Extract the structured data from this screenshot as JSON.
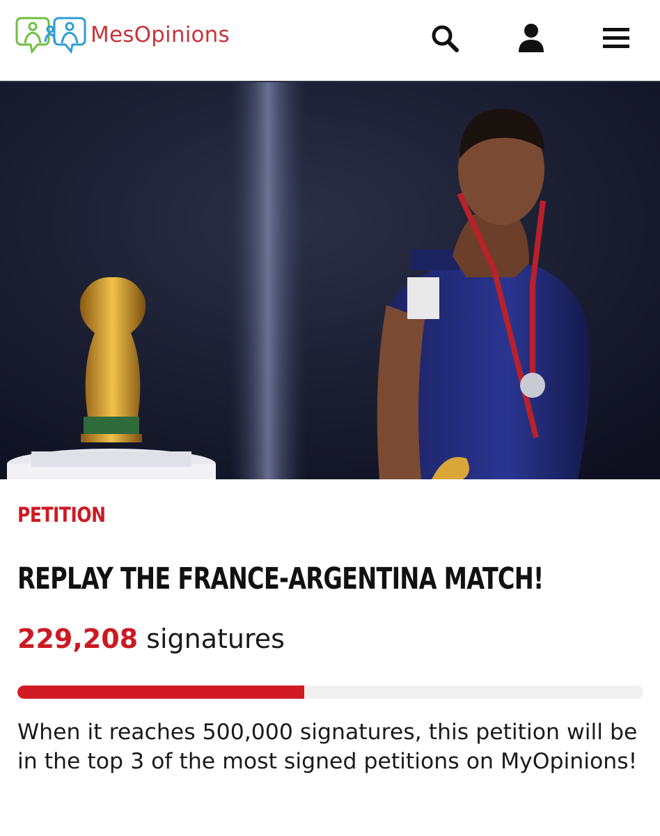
{
  "header": {
    "brand": "MesOpinions",
    "brand_color": "#c9343a",
    "icons": {
      "search": "search-icon",
      "account": "user-icon",
      "menu": "hamburger-menu-icon"
    }
  },
  "hero": {
    "alt": "hero-photo"
  },
  "petition": {
    "kicker": "PETITION",
    "title": "REPLAY THE FRANCE-ARGENTINA MATCH!",
    "signature_count": "229,208",
    "signature_label": "signatures",
    "progress_fraction": 0.458,
    "goal_text": "When it reaches 500,000 signatures, this petition will be in the top 3 of the most signed petitions on MyOpinions!"
  },
  "colors": {
    "accent": "#cc1a22",
    "progress_fill": "#d11a23",
    "progress_track": "#f0f0f0",
    "header_rule": "#2d3346"
  }
}
